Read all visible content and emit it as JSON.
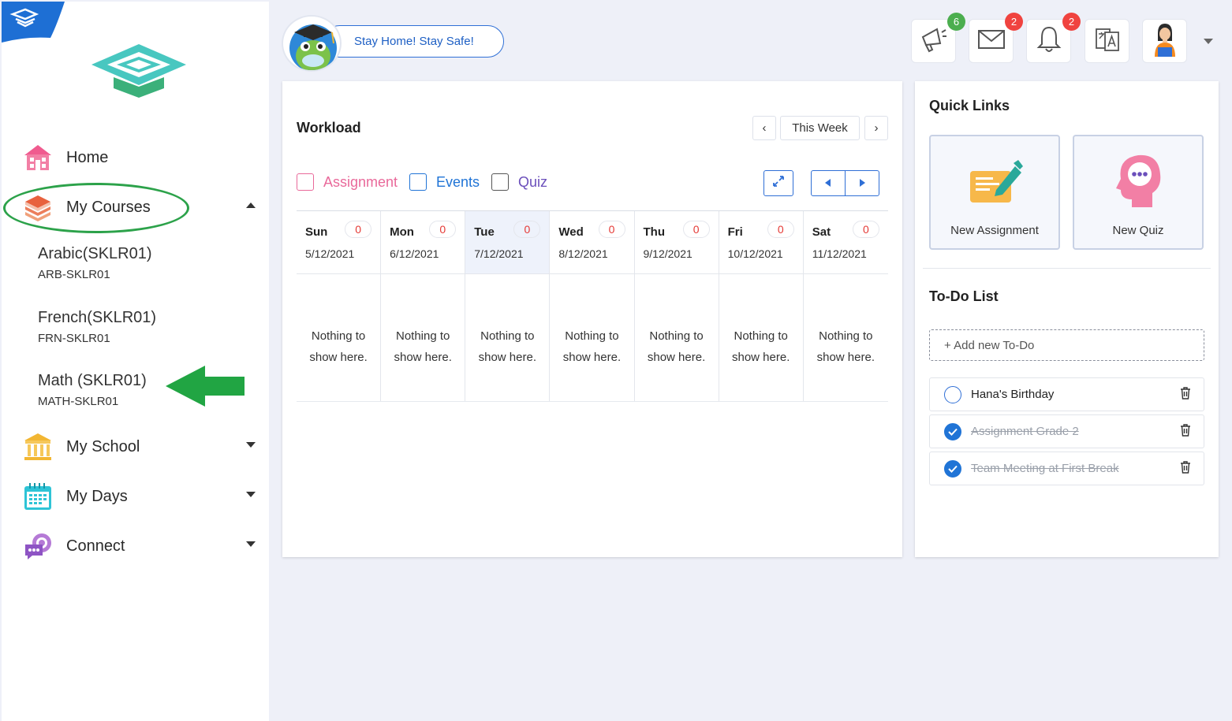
{
  "colors": {
    "accent_blue": "#2f6fd6",
    "badge_green": "#4cae4f",
    "badge_red": "#f0433f",
    "assignment_pink": "#e9699a",
    "events_blue": "#2074d6",
    "quiz_purple": "#6b4fbb",
    "annotation_green": "#2ca24a"
  },
  "sidebar": {
    "nav": {
      "home": {
        "label": "Home",
        "icon": "school-building-icon"
      },
      "my_courses": {
        "label": "My Courses",
        "icon": "books-stack-icon",
        "expanded": true
      },
      "my_school": {
        "label": "My School",
        "icon": "columns-building-icon"
      },
      "my_days": {
        "label": "My Days",
        "icon": "calendar-icon"
      },
      "connect": {
        "label": "Connect",
        "icon": "chat-bubbles-icon"
      }
    },
    "courses": [
      {
        "name": "Arabic(SKLR01)",
        "code": "ARB-SKLR01"
      },
      {
        "name": "French(SKLR01)",
        "code": "FRN-SKLR01"
      },
      {
        "name": "Math (SKLR01)",
        "code": "MATH-SKLR01"
      }
    ]
  },
  "header": {
    "slogan": "Stay Home! Stay Safe!",
    "buttons": {
      "announcements": {
        "icon": "megaphone-icon",
        "badge": "6"
      },
      "messages": {
        "icon": "envelope-icon",
        "badge": "2"
      },
      "notifications": {
        "icon": "bell-icon",
        "badge": "2"
      },
      "language": {
        "icon": "translate-icon"
      },
      "profile": {
        "icon": "teacher-avatar-icon"
      }
    }
  },
  "workload": {
    "title": "Workload",
    "period": "This Week",
    "filters": {
      "assignment": "Assignment",
      "events": "Events",
      "quiz": "Quiz"
    },
    "days": [
      {
        "name": "Sun",
        "date": "5/12/2021",
        "count": "0",
        "empty": "Nothing to show here."
      },
      {
        "name": "Mon",
        "date": "6/12/2021",
        "count": "0",
        "empty": "Nothing to show here."
      },
      {
        "name": "Tue",
        "date": "7/12/2021",
        "count": "0",
        "empty": "Nothing to show here."
      },
      {
        "name": "Wed",
        "date": "8/12/2021",
        "count": "0",
        "empty": "Nothing to show here."
      },
      {
        "name": "Thu",
        "date": "9/12/2021",
        "count": "0",
        "empty": "Nothing to show here."
      },
      {
        "name": "Fri",
        "date": "10/12/2021",
        "count": "0",
        "empty": "Nothing to show here."
      },
      {
        "name": "Sat",
        "date": "11/12/2021",
        "count": "0",
        "empty": "Nothing to show here."
      }
    ]
  },
  "quick_links": {
    "title": "Quick Links",
    "new_assignment": "New Assignment",
    "new_quiz": "New Quiz"
  },
  "todo": {
    "title": "To-Do List",
    "add_placeholder": "+ Add new To-Do",
    "items": [
      {
        "text": "Hana's Birthday",
        "done": false
      },
      {
        "text": "Assignment Grade 2",
        "done": true
      },
      {
        "text": "Team Meeting at First Break",
        "done": true
      }
    ]
  }
}
